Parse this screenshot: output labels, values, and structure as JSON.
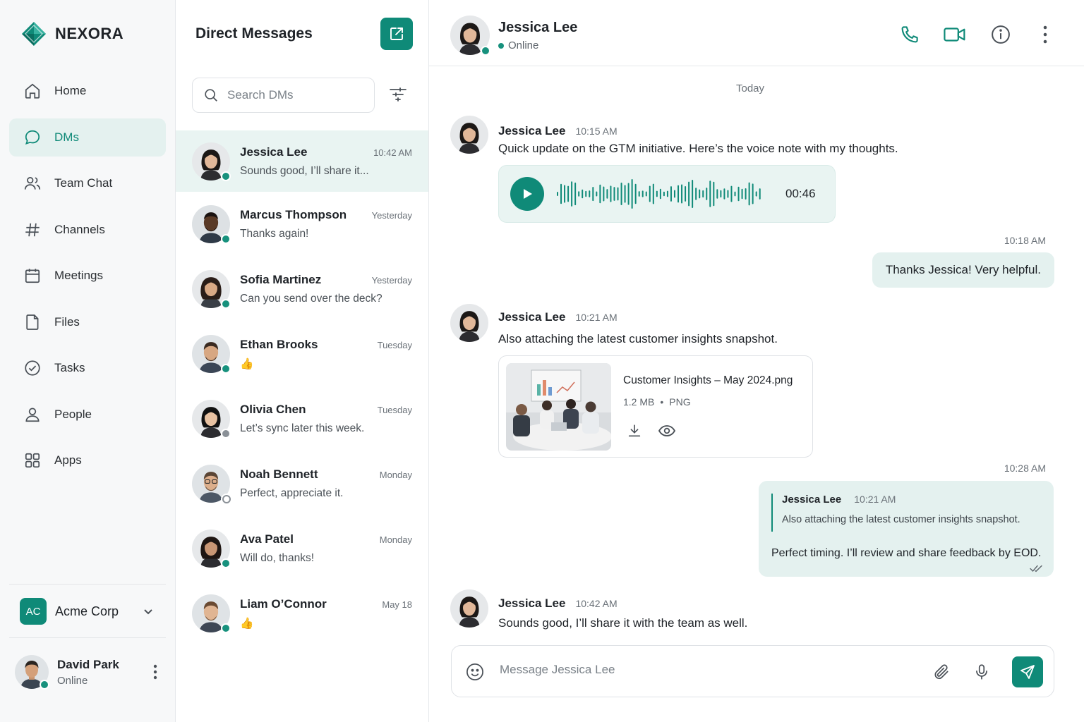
{
  "brand": {
    "name": "NEXORA",
    "color": "#0f8a78"
  },
  "nav": {
    "items": [
      {
        "label": "Home",
        "icon": "home-icon",
        "active": false
      },
      {
        "label": "DMs",
        "icon": "chat-bubble-icon",
        "active": true
      },
      {
        "label": "Team Chat",
        "icon": "team-icon",
        "active": false
      },
      {
        "label": "Channels",
        "icon": "hash-icon",
        "active": false
      },
      {
        "label": "Meetings",
        "icon": "calendar-icon",
        "active": false
      },
      {
        "label": "Files",
        "icon": "file-icon",
        "active": false
      },
      {
        "label": "Tasks",
        "icon": "check-circle-icon",
        "active": false
      },
      {
        "label": "People",
        "icon": "person-icon",
        "active": false
      },
      {
        "label": "Apps",
        "icon": "apps-grid-icon",
        "active": false
      }
    ],
    "workspace": {
      "initials": "AC",
      "name": "Acme Corp"
    },
    "user": {
      "name": "David Park",
      "status": "Online"
    }
  },
  "dm_panel": {
    "title": "Direct Messages",
    "search_placeholder": "Search DMs",
    "conversations": [
      {
        "name": "Jessica Lee",
        "time": "10:42 AM",
        "preview": "Sounds good, I’ll share it...",
        "presence": "online",
        "active": true
      },
      {
        "name": "Marcus Thompson",
        "time": "Yesterday",
        "preview": "Thanks again!",
        "presence": "online",
        "active": false
      },
      {
        "name": "Sofia Martinez",
        "time": "Yesterday",
        "preview": "Can you send over the deck?",
        "presence": "online",
        "active": false
      },
      {
        "name": "Ethan Brooks",
        "time": "Tuesday",
        "preview": "👍",
        "presence": "online",
        "active": false
      },
      {
        "name": "Olivia Chen",
        "time": "Tuesday",
        "preview": "Let’s sync later this week.",
        "presence": "away",
        "active": false
      },
      {
        "name": "Noah Bennett",
        "time": "Monday",
        "preview": "Perfect, appreciate it.",
        "presence": "offline",
        "active": false
      },
      {
        "name": "Ava Patel",
        "time": "Monday",
        "preview": "Will do, thanks!",
        "presence": "online",
        "active": false
      },
      {
        "name": "Liam O’Connor",
        "time": "May 18",
        "preview": "👍",
        "presence": "online",
        "active": false
      }
    ]
  },
  "chat": {
    "contact": {
      "name": "Jessica Lee",
      "status": "Online"
    },
    "day_label": "Today",
    "messages": {
      "m1": {
        "author": "Jessica Lee",
        "time": "10:15 AM",
        "text": "Quick update on the GTM initiative. Here’s the voice note with my thoughts."
      },
      "voice": {
        "duration": "00:46"
      },
      "out1": {
        "time": "10:18 AM",
        "text": "Thanks Jessica! Very helpful."
      },
      "m2": {
        "author": "Jessica Lee",
        "time": "10:21 AM",
        "text": "Also attaching the latest customer insights snapshot."
      },
      "file": {
        "name": "Customer Insights – May 2024.png",
        "size": "1.2 MB",
        "type": "PNG"
      },
      "out2": {
        "time": "10:28 AM",
        "quote_author": "Jessica Lee",
        "quote_time": "10:21 AM",
        "quote_text": "Also attaching the latest customer insights snapshot.",
        "text": "Perfect timing. I’ll review and share feedback by EOD."
      },
      "m3": {
        "author": "Jessica Lee",
        "time": "10:42 AM",
        "text": "Sounds good, I’ll share it with the team as well."
      }
    },
    "composer_placeholder": "Message Jessica Lee"
  },
  "colors": {
    "accent": "#0f8a78",
    "accent_soft": "#e4f1ef",
    "online": "#17917d"
  }
}
